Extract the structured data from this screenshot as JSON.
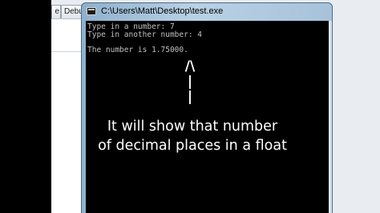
{
  "ide": {
    "tabs": [
      "e",
      "Debu"
    ]
  },
  "console_window": {
    "title": "C:\\Users\\Matt\\Desktop\\test.exe",
    "output_lines": [
      "Type in a number: 7",
      "Type in another number: 4",
      "",
      "The number is 1.75000."
    ]
  },
  "annotation": {
    "arrow_lines": [
      "/\\",
      "|",
      "|"
    ],
    "caption_lines": [
      "It will show that number",
      "of decimal places in a float"
    ]
  }
}
